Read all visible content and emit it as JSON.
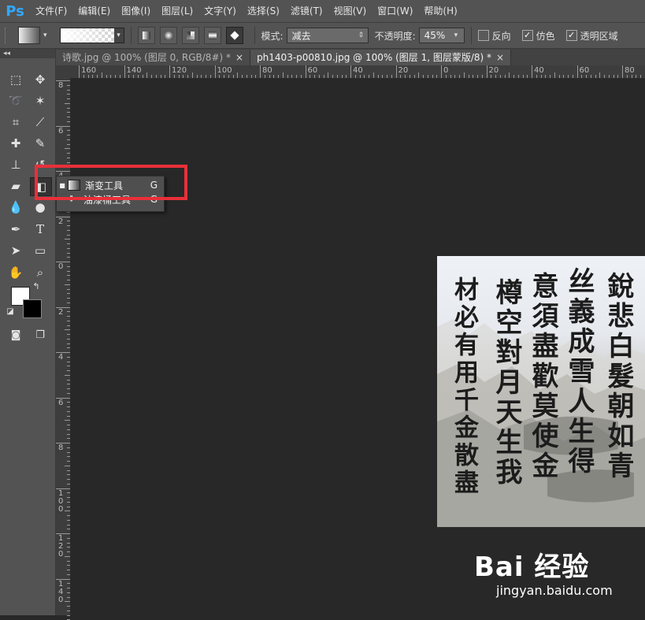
{
  "app": {
    "logo": "Ps"
  },
  "menubar": {
    "items": [
      "文件(F)",
      "编辑(E)",
      "图像(I)",
      "图层(L)",
      "文字(Y)",
      "选择(S)",
      "滤镜(T)",
      "视图(V)",
      "窗口(W)",
      "帮助(H)"
    ]
  },
  "options": {
    "mode_label": "模式:",
    "mode_value": "减去",
    "opacity_label": "不透明度:",
    "opacity_value": "45%",
    "reverse_label": "反向",
    "reverse_checked": false,
    "dither_label": "仿色",
    "dither_checked": true,
    "transparency_label": "透明区域",
    "transparency_checked": true
  },
  "tabs": [
    {
      "label": "诗歌.jpg @ 100% (图层 0, RGB/8#) *",
      "active": false
    },
    {
      "label": "ph1403-p00810.jpg @ 100% (图层 1, 图层蒙版/8) *",
      "active": true
    }
  ],
  "ruler_h": [
    "160",
    "140",
    "120",
    "100",
    "80",
    "60",
    "40",
    "20",
    "0",
    "20",
    "40",
    "60",
    "80"
  ],
  "ruler_v": [
    "8",
    "6",
    "4",
    "2",
    "0",
    "2",
    "4",
    "6",
    "8",
    "1\n0\n0",
    "1\n2\n0",
    "1\n4\n0"
  ],
  "flyout": {
    "items": [
      {
        "label": "渐变工具",
        "key": "G",
        "selected": true
      },
      {
        "label": "油漆桶工具",
        "key": "G",
        "selected": false
      }
    ]
  },
  "toolbar": {
    "collapse": "◂◂"
  },
  "image": {
    "calligraphy_columns": [
      "銳悲白髮朝如青",
      "丝義成雪人生得",
      "意須盡歡莫使金",
      "樽空對月天生我",
      "材必有用千金散盡"
    ]
  },
  "watermark": {
    "main": "Bai 经验",
    "sub": "jingyan.baidu.com"
  },
  "colors": {
    "highlight": "#e8303a",
    "accent": "#31a8ff"
  }
}
